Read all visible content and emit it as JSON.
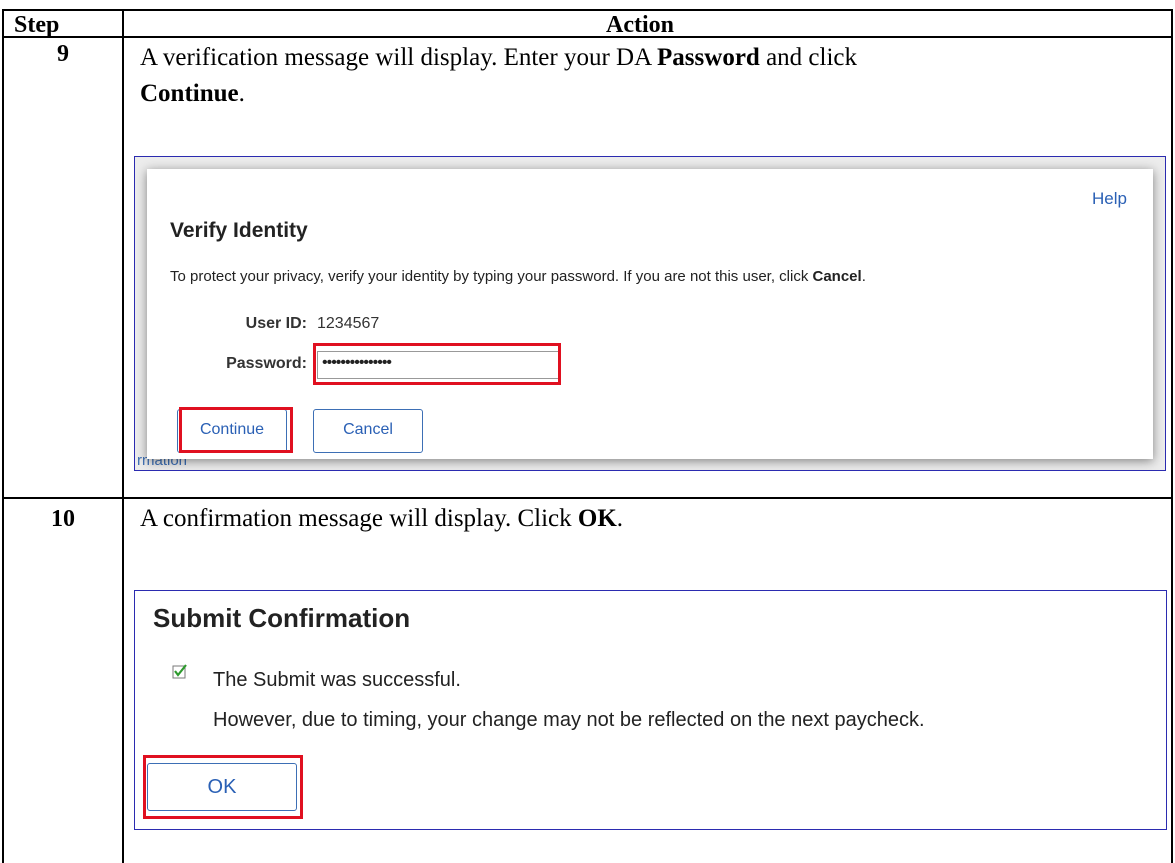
{
  "table": {
    "header_step": "Step",
    "header_action": "Action"
  },
  "rows": [
    {
      "step": "9",
      "text_1": "A verification message will display.  Enter your DA ",
      "bold_1": "Password",
      "text_2": " and click",
      "bold_2": "Continue",
      "text_3": "."
    },
    {
      "step": "10",
      "text_1": "A confirmation message will display.  Click ",
      "bold_1": "OK",
      "text_2": "."
    }
  ],
  "verify_dialog": {
    "help_label": "Help",
    "title": "Verify Identity",
    "message": "To protect your privacy, verify your identity by typing your password. If you are not this user, click ",
    "message_bold": "Cancel",
    "message_end": ".",
    "user_id_label": "User ID:",
    "user_id_value": "1234567",
    "password_label": "Password:",
    "password_value": "•••••••••••••••",
    "continue_label": "Continue",
    "cancel_label": "Cancel",
    "background_fragment": "rmation",
    "highlight_color": "#e01020"
  },
  "submit_confirmation": {
    "title": "Submit Confirmation",
    "icon": "checkbox-check-icon",
    "line_1": "The Submit was successful.",
    "line_2": "However, due to timing, your change may not be reflected on the next paycheck.",
    "ok_label": "OK"
  }
}
